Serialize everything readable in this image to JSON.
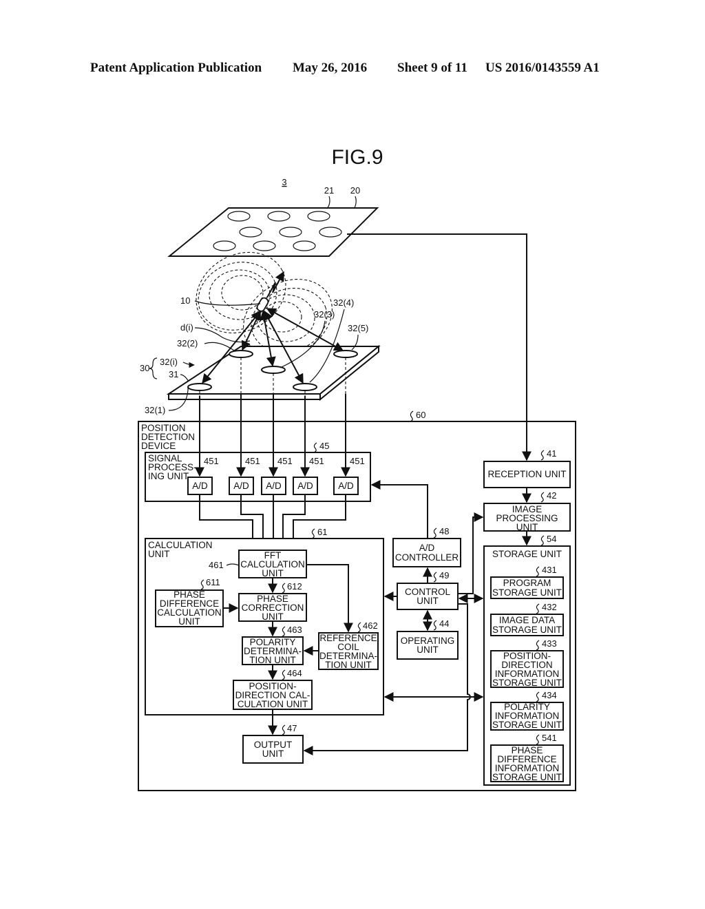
{
  "header": {
    "publication": "Patent Application Publication",
    "date": "May 26, 2016",
    "sheet": "Sheet 9 of 11",
    "number": "US 2016/0143559 A1"
  },
  "figure": {
    "title": "FIG.9",
    "system_ref": "3",
    "display_ref": "20",
    "display_element_ref": "21",
    "capsule_ref": "10",
    "distance_label": "d(i)",
    "coil_unit_ref": "30",
    "coil_generic_ref": "32(i)",
    "coil_board_ref": "31",
    "coils": [
      "32(1)",
      "32(2)",
      "32(3)",
      "32(4)",
      "32(5)"
    ],
    "device_ref": "60",
    "device_label": [
      "POSITION",
      "DETECTION",
      "DEVICE"
    ]
  },
  "blocks": {
    "signal_processing": {
      "ref": "45",
      "label": [
        "SIGNAL",
        "PROCESS-",
        "ING UNIT"
      ]
    },
    "ad_converters": [
      {
        "ref": "451",
        "label": "A/D"
      },
      {
        "ref": "451",
        "label": "A/D"
      },
      {
        "ref": "451",
        "label": "A/D"
      },
      {
        "ref": "451",
        "label": "A/D"
      },
      {
        "ref": "451",
        "label": "A/D"
      }
    ],
    "calculation": {
      "ref": "61",
      "label": [
        "CALCULATION",
        "UNIT"
      ]
    },
    "fft": {
      "ref": "461",
      "label": [
        "FFT",
        "CALCULATION",
        "UNIT"
      ]
    },
    "phase_difference": {
      "ref": "611",
      "label": [
        "PHASE",
        "DIFFERENCE",
        "CALCULATION",
        "UNIT"
      ]
    },
    "phase_correction": {
      "ref": "612",
      "label": [
        "PHASE",
        "CORRECTION",
        "UNIT"
      ]
    },
    "polarity": {
      "ref": "463",
      "label": [
        "POLARITY",
        "DETERMINA-",
        "TION UNIT"
      ]
    },
    "reference_coil": {
      "ref": "462",
      "label": [
        "REFERENCE",
        "COIL",
        "DETERMINA-",
        "TION UNIT"
      ]
    },
    "position_direction": {
      "ref": "464",
      "label": [
        "POSITION-",
        "DIRECTION CAL-",
        "CULATION UNIT"
      ]
    },
    "output": {
      "ref": "47",
      "label": [
        "OUTPUT",
        "UNIT"
      ]
    },
    "ad_controller": {
      "ref": "48",
      "label": [
        "A/D",
        "CONTROLLER"
      ]
    },
    "control": {
      "ref": "49",
      "label": [
        "CONTROL",
        "UNIT"
      ]
    },
    "operating": {
      "ref": "44",
      "label": [
        "OPERATING",
        "UNIT"
      ]
    },
    "reception": {
      "ref": "41",
      "label": [
        "RECEPTION UNIT"
      ]
    },
    "image_processing": {
      "ref": "42",
      "label": [
        "IMAGE",
        "PROCESSING",
        "UNIT"
      ]
    },
    "storage": {
      "ref": "54",
      "label": [
        "STORAGE UNIT"
      ]
    },
    "program_storage": {
      "ref": "431",
      "label": [
        "PROGRAM",
        "STORAGE UNIT"
      ]
    },
    "image_data_storage": {
      "ref": "432",
      "label": [
        "IMAGE DATA",
        "STORAGE UNIT"
      ]
    },
    "position_direction_storage": {
      "ref": "433",
      "label": [
        "POSITION-",
        "DIRECTION",
        "INFORMATION",
        "STORAGE UNIT"
      ]
    },
    "polarity_storage": {
      "ref": "434",
      "label": [
        "POLARITY",
        "INFORMATION",
        "STORAGE UNIT"
      ]
    },
    "phase_difference_storage": {
      "ref": "541",
      "label": [
        "PHASE",
        "DIFFERENCE",
        "INFORMATION",
        "STORAGE UNIT"
      ]
    }
  }
}
